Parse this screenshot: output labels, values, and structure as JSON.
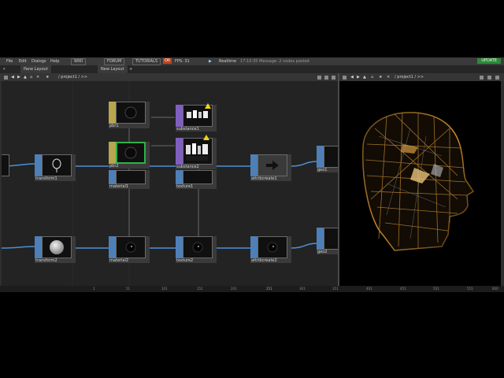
{
  "menubar": {
    "items": [
      "File",
      "Edit",
      "Dialogs",
      "Help"
    ],
    "wiki": "WIKI",
    "forum": "FORUM",
    "tutorials": "TUTORIALS",
    "rec": "OII",
    "fps": "FPS: 31",
    "realtime": "Realtime",
    "message": "17:10:35 Message: 2 nodes pasted",
    "update": "UPDATE"
  },
  "tabs": {
    "pane_layout": "Pane Layout",
    "new_layout": "New Layout",
    "add": "+"
  },
  "network_toolbar": {
    "path": "/ project1 / >>"
  },
  "viewer_toolbar": {
    "path": "/ project1 / >>"
  },
  "nodes": [
    {
      "id": "pbr1",
      "label": "pbr1",
      "color": "yellow"
    },
    {
      "id": "substance1",
      "label": "substance1",
      "color": "purple",
      "warning": true
    },
    {
      "id": "pbr2",
      "label": "pbr2",
      "color": "yellow",
      "selected": true
    },
    {
      "id": "substance2",
      "label": "substance2",
      "color": "purple",
      "warning": true
    },
    {
      "id": "transform1",
      "label": "transform1",
      "color": "blue"
    },
    {
      "id": "material1",
      "label": "material1",
      "color": "blue"
    },
    {
      "id": "texture1",
      "label": "texture1",
      "color": "blue"
    },
    {
      "id": "attribcreate1",
      "label": "attribcreate1",
      "color": "blue"
    },
    {
      "id": "geo1",
      "label": "geo1",
      "color": "blue"
    },
    {
      "id": "transform2",
      "label": "transform2",
      "color": "blue"
    },
    {
      "id": "material2",
      "label": "material2",
      "color": "blue"
    },
    {
      "id": "texture2",
      "label": "texture2",
      "color": "blue"
    },
    {
      "id": "attribcreate2",
      "label": "attribcreate2",
      "color": "blue"
    },
    {
      "id": "geo2",
      "label": "geo2",
      "color": "blue"
    }
  ],
  "timeline": {
    "ticks": [
      "1",
      "51",
      "101",
      "151",
      "201",
      "251",
      "301",
      "351",
      "401",
      "451",
      "501",
      "551",
      "600"
    ]
  }
}
